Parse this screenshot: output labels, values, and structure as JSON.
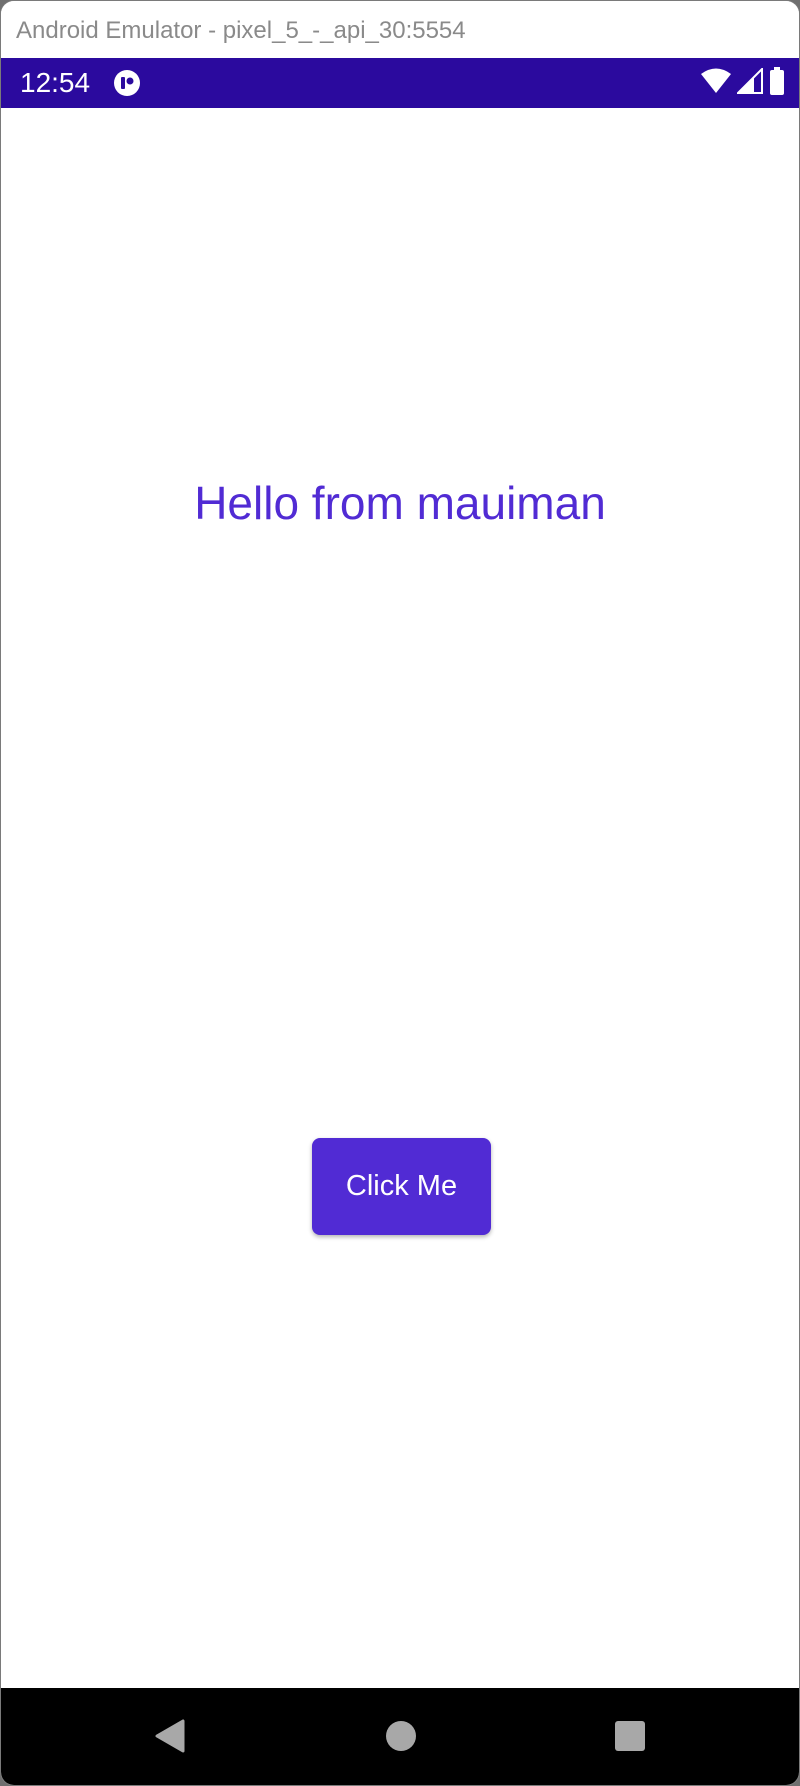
{
  "window": {
    "title": "Android Emulator - pixel_5_-_api_30:5554"
  },
  "status_bar": {
    "time": "12:54",
    "background_color": "#2b0a9e",
    "icons": [
      "app-notification-icon",
      "wifi-icon",
      "cellular-signal-icon",
      "battery-icon"
    ]
  },
  "main": {
    "greeting": "Hello from mauiman",
    "greeting_color": "#512bd4",
    "button_label": "Click Me",
    "button_color": "#512bd4"
  },
  "nav_bar": {
    "buttons": [
      "back-icon",
      "home-icon",
      "recents-icon"
    ]
  }
}
